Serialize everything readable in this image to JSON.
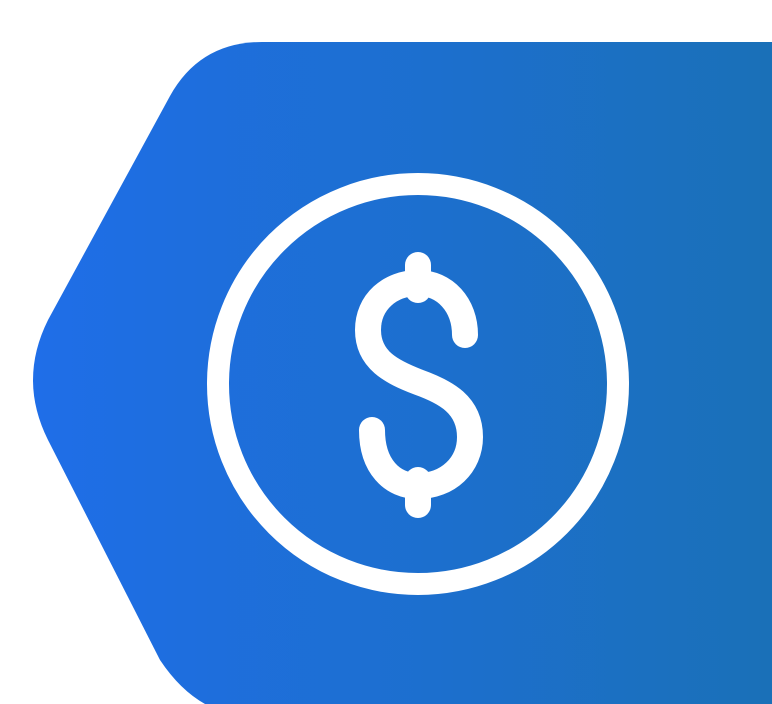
{
  "graphic": {
    "shape": "rounded-hexagon-badge",
    "icon": "dollar-coin-icon",
    "colors": {
      "background": "#ffffff",
      "gradient_start": "#1f6ee8",
      "gradient_end": "#1a70b6",
      "icon_stroke": "#ffffff"
    }
  }
}
